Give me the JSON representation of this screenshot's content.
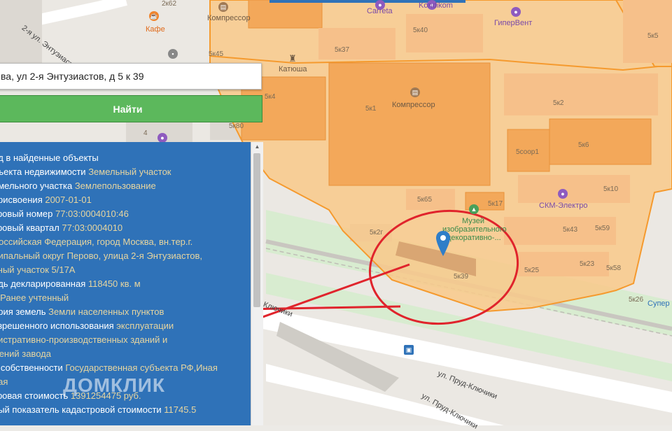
{
  "search": {
    "value": "ва, ул 2-я Энтузиастов, д 5 к 39",
    "button_label": "Найти"
  },
  "info": {
    "rows": [
      {
        "key": "ад в найденные объекты",
        "value": ""
      },
      {
        "key": "бъекта недвижимости ",
        "value": "Земельный участок"
      },
      {
        "key": "емельного участка ",
        "value": "Землепользование"
      },
      {
        "key": "присвоения ",
        "value": "2007-01-01"
      },
      {
        "key": "тровый номер ",
        "value": "77:03:0004010:46"
      },
      {
        "key": "тровый квартал ",
        "value": "77:03:0004010"
      },
      {
        "key": " ",
        "value": "Российская Федерация, город Москва, вн.тер.г."
      },
      {
        "key": "",
        "value": "ципальный округ Перово, улица 2-я Энтузиастов,"
      },
      {
        "key": "",
        "value": "ьный участок 5/17А"
      },
      {
        "key": "адь декларированная ",
        "value": "118450 кв. м"
      },
      {
        "key": "с ",
        "value": "Ранее учтенный"
      },
      {
        "key": "ория земель ",
        "value": "Земли населенных пунктов"
      },
      {
        "key": "азрешенного использования ",
        "value": "эксплуатации"
      },
      {
        "key": "",
        "value": "нистративно-производственных зданий и"
      },
      {
        "key": "",
        "value": "жений завода"
      },
      {
        "key": "а собственности ",
        "value": "Государственная субъекта РФ,Иная"
      },
      {
        "key": "",
        "value": "ная"
      },
      {
        "key": "тровая стоимость ",
        "value": "1391254475 руб."
      },
      {
        "key": "ный показатель кадастровой стоимости ",
        "value": "11745.5"
      }
    ]
  },
  "watermark": "ДОМКЛИК",
  "map": {
    "streets": {
      "entuziastov": "2-я ул. Энтузиастов",
      "klyuchiki1": "ул. Пруд-Ключики",
      "klyuchiki2": "ул. Пруд-Ключики",
      "klyuchiki3": "-Ключики"
    },
    "pois": {
      "cafe": "Кафе",
      "kompressor_top": "Компрессор",
      "carreta": "Carreta",
      "kondikom": "Kondikom",
      "gipervent": "ГиперВент",
      "katyusha": "Катюша",
      "kompressor_main": "Компрессор",
      "skm": "СКМ-Электро",
      "museum1": "Музей",
      "museum2": "изобразительного",
      "museum3": "декоративно-...",
      "super": "Супер"
    },
    "buildings": [
      "5к45",
      "5к37",
      "5к40",
      "5к4",
      "5к1",
      "5к2",
      "5к80",
      "5соор1",
      "5к6",
      "5к10",
      "5к65",
      "5к17",
      "5к43",
      "5к59",
      "5к2г",
      "5к39",
      "5к25",
      "5к23",
      "5к58",
      "5к26",
      "5к5",
      "4"
    ],
    "top_fragment": "2к62"
  },
  "colors": {
    "parcel_fill": "#f9c98a",
    "parcel_border": "#f59a2e",
    "building": "#f2b77a",
    "button": "#5cb85c",
    "panel": "#2f72b8",
    "annotation": "#e0242c"
  }
}
